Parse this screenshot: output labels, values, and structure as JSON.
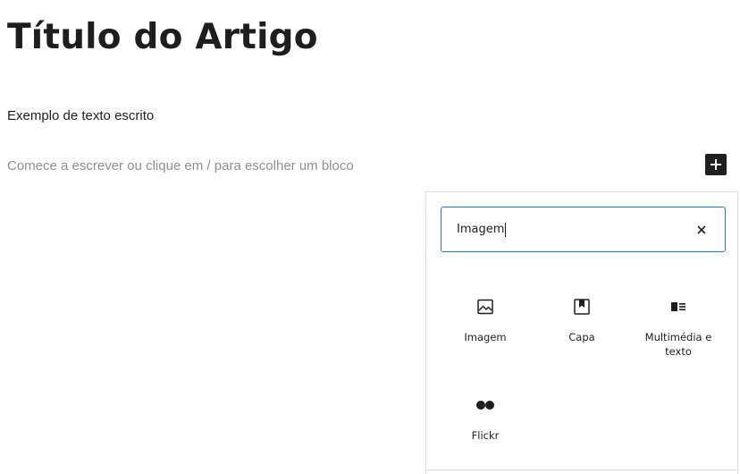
{
  "post": {
    "title": "Título do Artigo",
    "paragraph": "Exemplo de texto escrito",
    "placeholder": "Comece a escrever ou clique em / para escolher um bloco"
  },
  "inserter": {
    "toggle_icon": "plus-icon",
    "search": {
      "value": "Imagem",
      "clear_icon": "close-icon"
    },
    "blocks": [
      {
        "label": "Imagem",
        "icon": "image-icon"
      },
      {
        "label": "Capa",
        "icon": "cover-icon"
      },
      {
        "label": "Multimédia e texto",
        "icon": "media-text-icon"
      },
      {
        "label": "Flickr",
        "icon": "flickr-icon"
      }
    ]
  },
  "colors": {
    "text": "#1e1e1e",
    "placeholder": "#8c8f94",
    "focus": "#1e7fb5",
    "border": "#dcdcde"
  }
}
